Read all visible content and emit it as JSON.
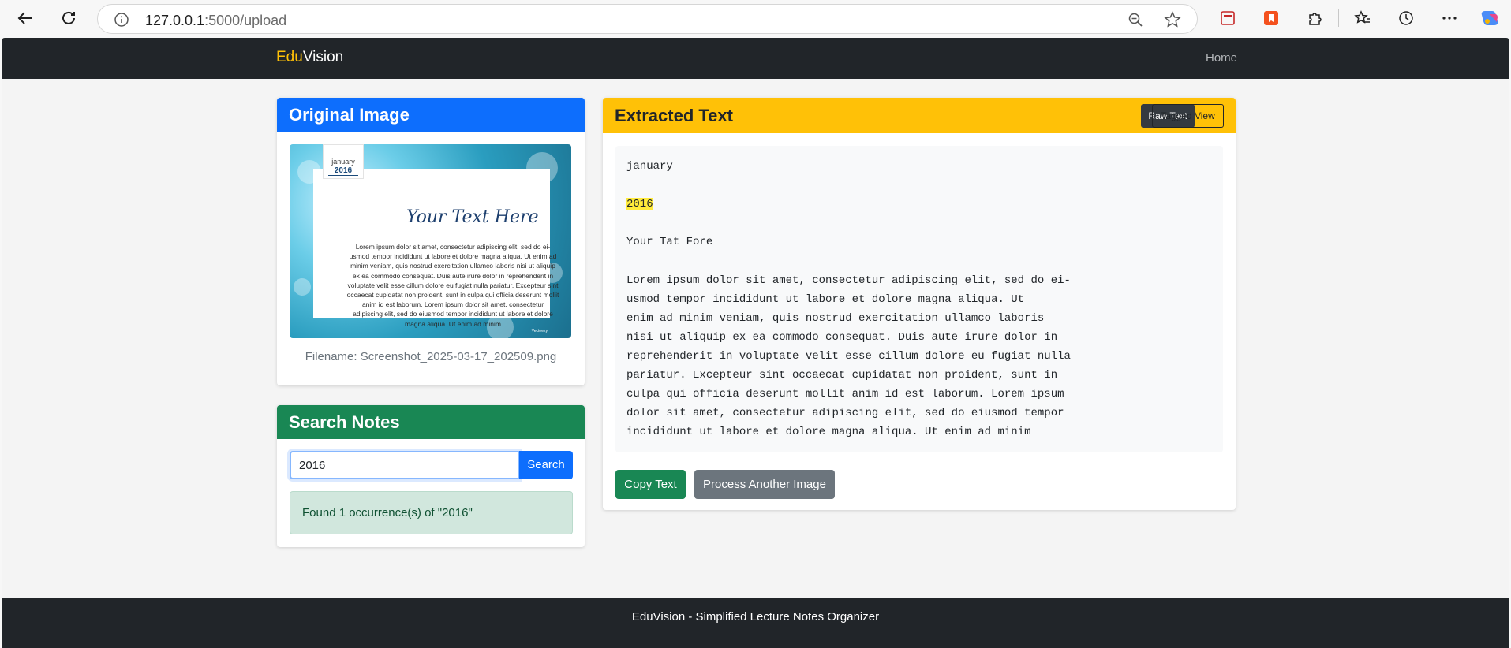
{
  "browser": {
    "url_host": "127.0.0.1",
    "url_path": ":5000/upload"
  },
  "navbar": {
    "brand_edu": "Edu",
    "brand_vision": "Vision",
    "home_label": "Home"
  },
  "original_image": {
    "title": "Original Image",
    "thumb_month": "january",
    "thumb_year": "2016",
    "thumb_heading": "Your Text Here",
    "thumb_body": "Lorem ipsum dolor sit amet, consectetur adipiscing elit, sed do ei-usmod tempor incididunt ut labore et dolore magna aliqua. Ut enim ad minim veniam, quis nostrud exercitation ullamco laboris nisi ut aliquip ex ea commodo consequat. Duis aute irure dolor in reprehenderit in voluptate velit esse cillum dolore eu fugiat nulla pariatur. Excepteur sint occaecat cupidatat non proident, sunt in culpa qui officia deserunt mollit anim id est laborum. Lorem ipsum dolor sit amet, consectetur adipiscing elit, sed do eiusmod tempor incididunt ut labore et dolore magna aliqua. Ut enim ad minim",
    "thumb_credit": "Vecteezy",
    "filename": "Filename: Screenshot_2025-03-17_202509.png"
  },
  "search": {
    "title": "Search Notes",
    "input_value": "2016",
    "button_label": "Search",
    "result": "Found 1 occurrence(s) of \"2016\""
  },
  "extracted": {
    "title": "Extracted Text",
    "raw_label": "Raw Text",
    "tagged_label": "Tagged View",
    "line_month": "january",
    "line_year": "2016",
    "line_heading": "Your Tat Fore",
    "body": "Lorem ipsum dolor sit amet, consectetur adipiscing elit, sed do ei-\nusmod tempor incididunt ut labore et dolore magna aliqua. Ut\nenim ad minim veniam, quis nostrud exercitation ullamco laboris\nnisi ut aliquip ex ea commodo consequat. Duis aute irure dolor in\nreprehenderit in voluptate velit esse cillum dolore eu fugiat nulla\npariatur. Excepteur sint occaecat cupidatat non proident, sunt in\nculpa qui officia deserunt mollit anim id est laborum. Lorem ipsum\ndolor sit amet, consectetur adipiscing elit, sed do eiusmod tempor\nincididunt ut labore et dolore magna aliqua. Ut enim ad minim",
    "copy_label": "Copy Text",
    "another_label": "Process Another Image",
    "highlight_color": "#ffeb3b"
  },
  "footer": {
    "text": "EduVision - Simplified Lecture Notes Organizer"
  },
  "colors": {
    "primary": "#0d6efd",
    "success": "#198754",
    "warning": "#ffc107",
    "dark": "#212529"
  }
}
